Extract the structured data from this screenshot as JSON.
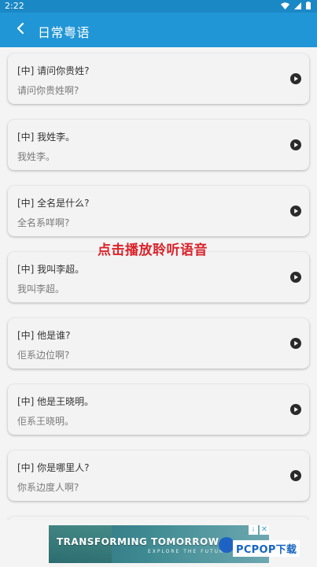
{
  "status_bar": {
    "time": "2:22"
  },
  "app_bar": {
    "title": "日常粤语"
  },
  "phrases": [
    {
      "question": "[中] 请问你贵姓?",
      "answer": "请问你贵姓啊?"
    },
    {
      "question": "[中] 我姓李。",
      "answer": "我姓李。"
    },
    {
      "question": "[中] 全名是什么?",
      "answer": "全名系咩啊?"
    },
    {
      "question": "[中] 我叫李超。",
      "answer": "我叫李超。"
    },
    {
      "question": "[中] 他是谁?",
      "answer": "佢系边位啊?"
    },
    {
      "question": "[中] 他是王晓明。",
      "answer": "佢系王晓明。"
    },
    {
      "question": "[中] 你是哪里人?",
      "answer": "你系边度人啊?"
    }
  ],
  "overlay_hint": "点击播放聆听语音",
  "ad": {
    "headline": "TRANSFORMING TOMORROW",
    "subline": "EXPLORE THE FUTURE",
    "close_label": "✕",
    "info_label": "i"
  },
  "brand": "PCPOP下载"
}
